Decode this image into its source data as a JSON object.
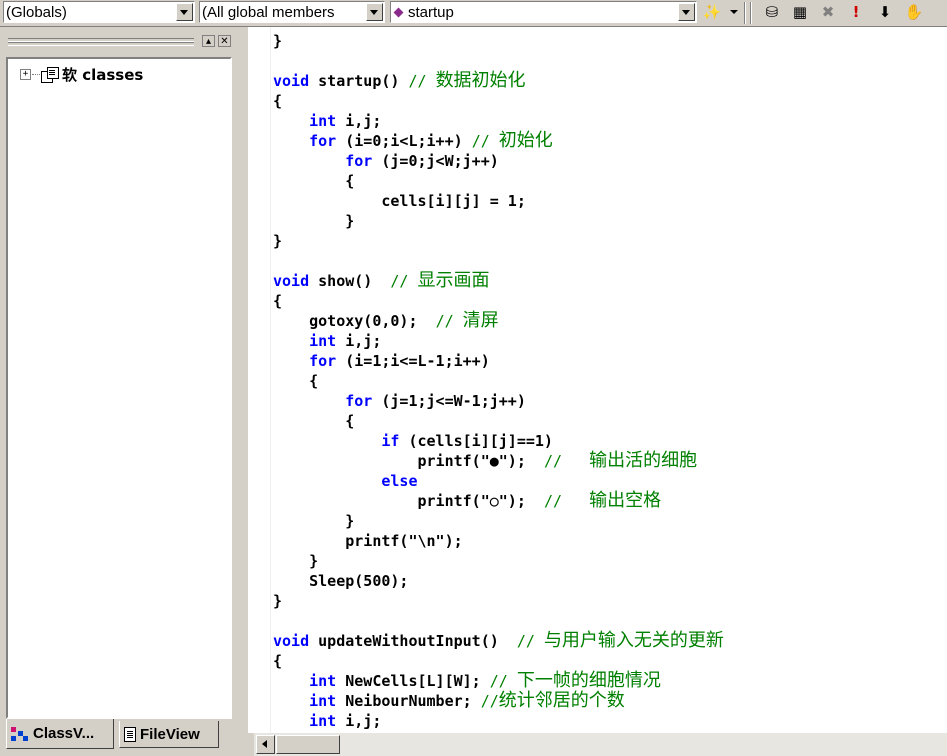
{
  "toolbar": {
    "scope_combo": "(Globals)",
    "members_combo": "(All global members",
    "function_combo": "startup"
  },
  "tree": {
    "root_label": "软 classes",
    "expander": "+"
  },
  "tabs": [
    {
      "label": "ClassV..."
    },
    {
      "label": "FileView"
    }
  ],
  "code_lines": [
    [
      {
        "t": "}",
        "c": "n"
      }
    ],
    [],
    [
      {
        "t": "void",
        "c": "k"
      },
      {
        "t": " startup() ",
        "c": "n"
      },
      {
        "t": "// 数据初始化",
        "c": "c"
      }
    ],
    [
      {
        "t": "{",
        "c": "n"
      }
    ],
    [
      {
        "t": "    ",
        "c": "n"
      },
      {
        "t": "int",
        "c": "k"
      },
      {
        "t": " i,j;",
        "c": "n"
      }
    ],
    [
      {
        "t": "    ",
        "c": "n"
      },
      {
        "t": "for",
        "c": "k"
      },
      {
        "t": " (i=0;i<L;i++) ",
        "c": "n"
      },
      {
        "t": "// 初始化",
        "c": "c"
      }
    ],
    [
      {
        "t": "        ",
        "c": "n"
      },
      {
        "t": "for",
        "c": "k"
      },
      {
        "t": " (j=0;j<W;j++)",
        "c": "n"
      }
    ],
    [
      {
        "t": "        {",
        "c": "n"
      }
    ],
    [
      {
        "t": "            cells[i][j] = 1;",
        "c": "n"
      }
    ],
    [
      {
        "t": "        }",
        "c": "n"
      }
    ],
    [
      {
        "t": "}",
        "c": "n"
      }
    ],
    [],
    [
      {
        "t": "void",
        "c": "k"
      },
      {
        "t": " show()  ",
        "c": "n"
      },
      {
        "t": "// 显示画面",
        "c": "c"
      }
    ],
    [
      {
        "t": "{",
        "c": "n"
      }
    ],
    [
      {
        "t": "    gotoxy(0,0);  ",
        "c": "n"
      },
      {
        "t": "// 清屏",
        "c": "c"
      }
    ],
    [
      {
        "t": "    ",
        "c": "n"
      },
      {
        "t": "int",
        "c": "k"
      },
      {
        "t": " i,j;",
        "c": "n"
      }
    ],
    [
      {
        "t": "    ",
        "c": "n"
      },
      {
        "t": "for",
        "c": "k"
      },
      {
        "t": " (i=1;i<=L-1;i++)",
        "c": "n"
      }
    ],
    [
      {
        "t": "    {",
        "c": "n"
      }
    ],
    [
      {
        "t": "        ",
        "c": "n"
      },
      {
        "t": "for",
        "c": "k"
      },
      {
        "t": " (j=1;j<=W-1;j++)",
        "c": "n"
      }
    ],
    [
      {
        "t": "        {",
        "c": "n"
      }
    ],
    [
      {
        "t": "            ",
        "c": "n"
      },
      {
        "t": "if",
        "c": "k"
      },
      {
        "t": " (cells[i][j]==1)",
        "c": "n"
      }
    ],
    [
      {
        "t": "                printf(\"",
        "c": "n"
      },
      {
        "t": "●",
        "c": "g"
      },
      {
        "t": "\");  ",
        "c": "n"
      },
      {
        "t": "//   输出活的细胞",
        "c": "c"
      }
    ],
    [
      {
        "t": "            ",
        "c": "n"
      },
      {
        "t": "else",
        "c": "k"
      }
    ],
    [
      {
        "t": "                printf(\"",
        "c": "n"
      },
      {
        "t": "○",
        "c": "g"
      },
      {
        "t": "\");  ",
        "c": "n"
      },
      {
        "t": "//   输出空格",
        "c": "c"
      }
    ],
    [
      {
        "t": "        }",
        "c": "n"
      }
    ],
    [
      {
        "t": "        printf(\"\\n\");",
        "c": "n"
      }
    ],
    [
      {
        "t": "    }",
        "c": "n"
      }
    ],
    [
      {
        "t": "    Sleep(500);",
        "c": "n"
      }
    ],
    [
      {
        "t": "}",
        "c": "n"
      }
    ],
    [],
    [
      {
        "t": "void",
        "c": "k"
      },
      {
        "t": " updateWithoutInput()  ",
        "c": "n"
      },
      {
        "t": "// 与用户输入无关的更新",
        "c": "c"
      }
    ],
    [
      {
        "t": "{",
        "c": "n"
      }
    ],
    [
      {
        "t": "    ",
        "c": "n"
      },
      {
        "t": "int",
        "c": "k"
      },
      {
        "t": " NewCells[L][W]; ",
        "c": "n"
      },
      {
        "t": "// 下一帧的细胞情况",
        "c": "c"
      }
    ],
    [
      {
        "t": "    ",
        "c": "n"
      },
      {
        "t": "int",
        "c": "k"
      },
      {
        "t": " NeibourNumber; ",
        "c": "n"
      },
      {
        "t": "//统计邻居的个数",
        "c": "c"
      }
    ],
    [
      {
        "t": "    ",
        "c": "n"
      },
      {
        "t": "int",
        "c": "k"
      },
      {
        "t": " i,j;",
        "c": "n"
      }
    ]
  ]
}
